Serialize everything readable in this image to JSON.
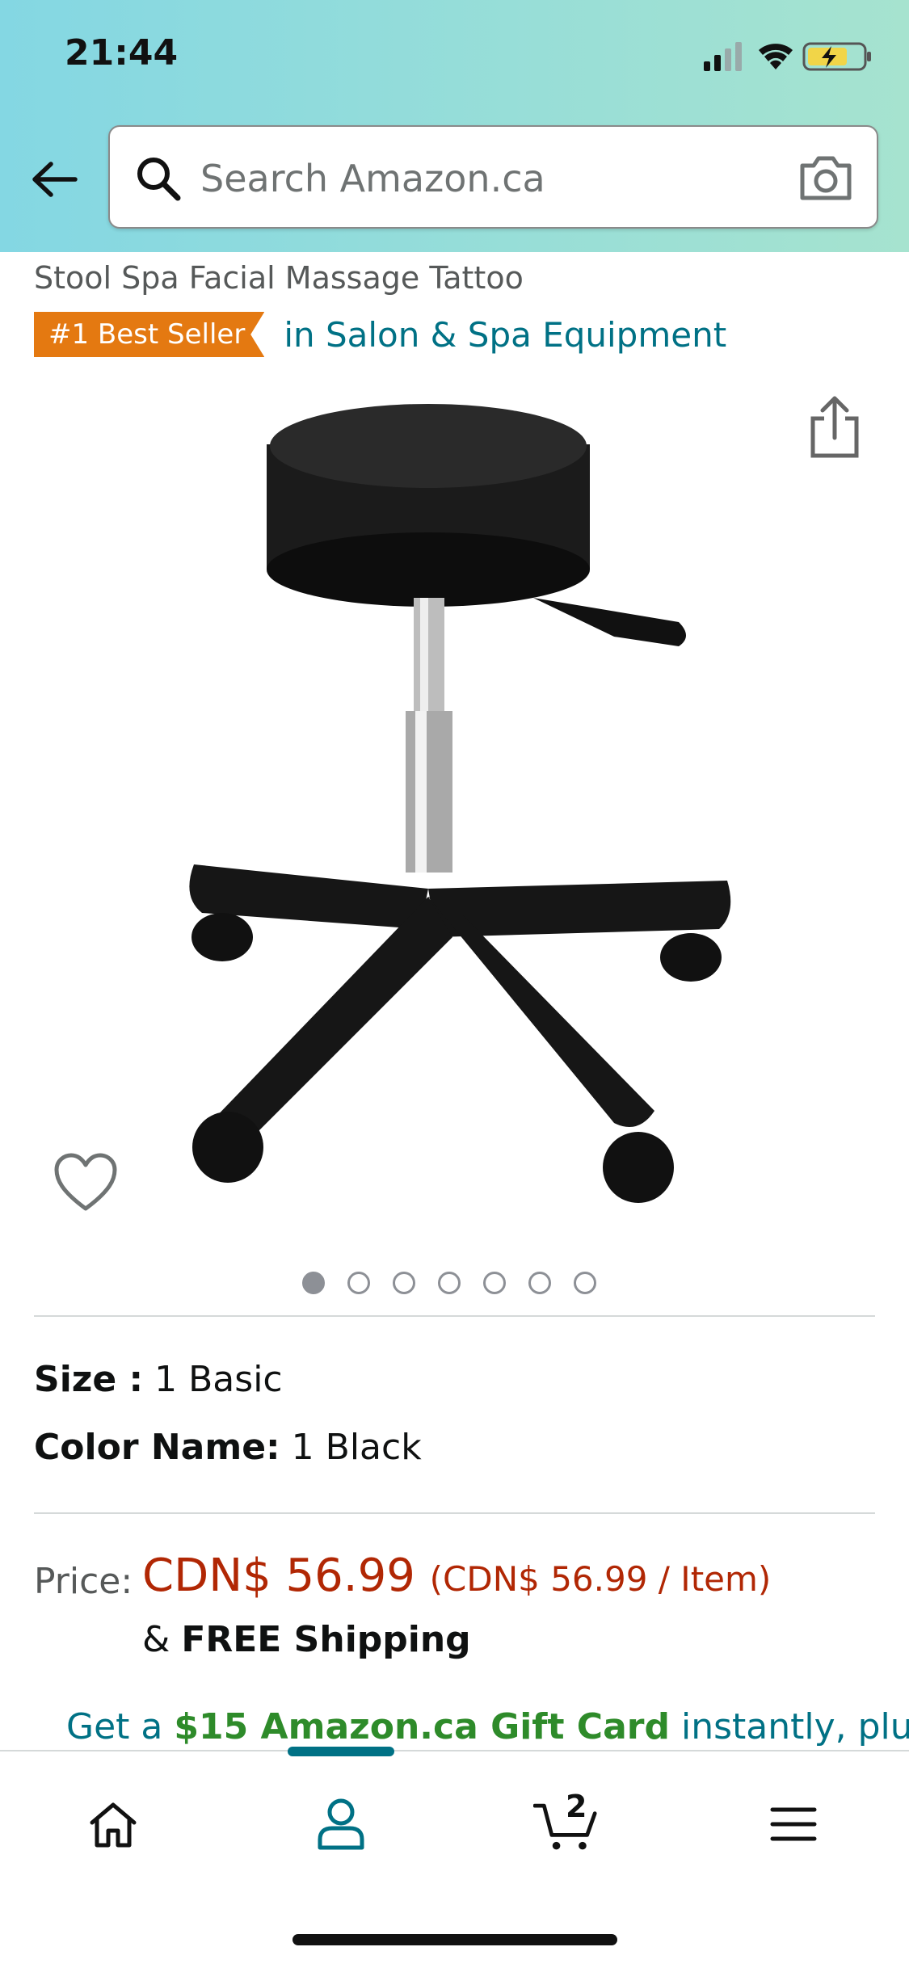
{
  "status_bar": {
    "time": "21:44"
  },
  "search": {
    "placeholder": "Search Amazon.ca"
  },
  "product": {
    "title_visible": "Stool Spa Facial Massage Tattoo",
    "badge": "#1 Best Seller",
    "category": "in Salon & Spa Equipment"
  },
  "gallery": {
    "image_count": 7,
    "active_index": 0
  },
  "variations": {
    "size_label": "Size :",
    "size_value": "1 Basic",
    "color_label": "Color Name:",
    "color_value": "1 Black"
  },
  "pricing": {
    "label": "Price:",
    "price": "CDN$ 56.99",
    "unit_price": "(CDN$ 56.99 / Item)",
    "shipping_prefix": "&",
    "shipping": "FREE Shipping"
  },
  "promo": {
    "prefix": "Get a",
    "highlight": "$15 Amazon.ca Gift Card",
    "suffix": "instantly, plus"
  },
  "bottom_nav": {
    "cart_count": "2"
  },
  "colors": {
    "header_gradient_start": "#84d7e3",
    "header_gradient_end": "#a6e3cf",
    "link": "#007185",
    "price": "#b12704",
    "badge": "#e47911",
    "promo_green": "#2e8b2a"
  }
}
